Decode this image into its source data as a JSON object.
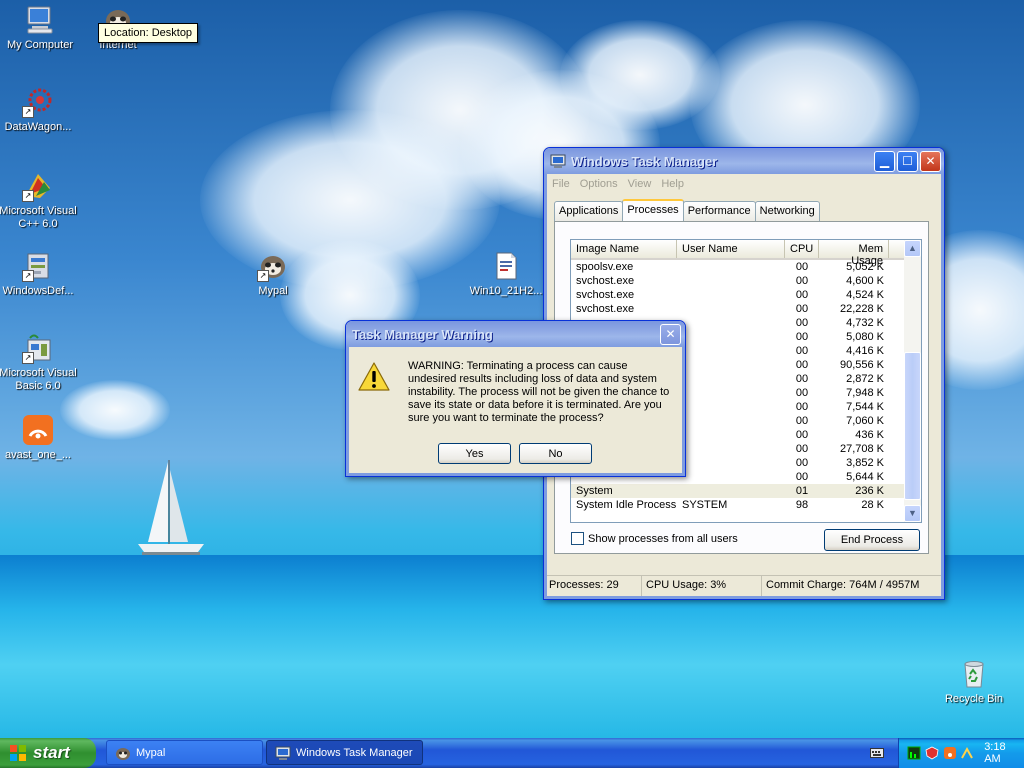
{
  "desktop": {
    "icons": [
      {
        "label": "My Computer"
      },
      {
        "label": "Internet"
      },
      {
        "label": "DataWagon..."
      },
      {
        "label": "Microsoft Visual C++ 6.0"
      },
      {
        "label": "WindowsDef..."
      },
      {
        "label": "Mypal"
      },
      {
        "label": "Win10_21H2..."
      },
      {
        "label": "Microsoft Visual Basic 6.0"
      },
      {
        "label": "avast_one_..."
      },
      {
        "label": "Recycle Bin"
      }
    ],
    "tooltip": "Location: Desktop"
  },
  "taskmgr": {
    "title": "Windows Task Manager",
    "menu": [
      "File",
      "Options",
      "View",
      "Help"
    ],
    "tabs": [
      "Applications",
      "Processes",
      "Performance",
      "Networking"
    ],
    "selected_tab": "Processes",
    "columns": [
      "Image Name",
      "User Name",
      "CPU",
      "Mem Usage"
    ],
    "rows": [
      {
        "name": "spoolsv.exe",
        "user": "",
        "cpu": "00",
        "mem": "5,052 K"
      },
      {
        "name": "svchost.exe",
        "user": "",
        "cpu": "00",
        "mem": "4,600 K"
      },
      {
        "name": "svchost.exe",
        "user": "",
        "cpu": "00",
        "mem": "4,524 K"
      },
      {
        "name": "svchost.exe",
        "user": "",
        "cpu": "00",
        "mem": "22,228 K"
      },
      {
        "name": "",
        "user": "",
        "cpu": "00",
        "mem": "4,732 K"
      },
      {
        "name": "",
        "user": "",
        "cpu": "00",
        "mem": "5,080 K"
      },
      {
        "name": "",
        "user": "",
        "cpu": "00",
        "mem": "4,416 K"
      },
      {
        "name": "",
        "user": "",
        "cpu": "00",
        "mem": "90,556 K"
      },
      {
        "name": "",
        "user": "",
        "cpu": "00",
        "mem": "2,872 K"
      },
      {
        "name": "",
        "user": "",
        "cpu": "00",
        "mem": "7,948 K"
      },
      {
        "name": "",
        "user": "",
        "cpu": "00",
        "mem": "7,544 K"
      },
      {
        "name": "",
        "user": "",
        "cpu": "00",
        "mem": "7,060 K"
      },
      {
        "name": "",
        "user": "",
        "cpu": "00",
        "mem": "436 K"
      },
      {
        "name": "",
        "user": "",
        "cpu": "00",
        "mem": "27,708 K"
      },
      {
        "name": "",
        "user": "",
        "cpu": "00",
        "mem": "3,852 K"
      },
      {
        "name": "",
        "user": "",
        "cpu": "00",
        "mem": "5,644 K"
      },
      {
        "name": "System",
        "user": "",
        "cpu": "01",
        "mem": "236 K"
      },
      {
        "name": "System Idle Process",
        "user": "SYSTEM",
        "cpu": "98",
        "mem": "28 K"
      }
    ],
    "show_all_label": "Show processes from all users",
    "end_process_label": "End Process",
    "status": {
      "processes": "Processes: 29",
      "cpu": "CPU Usage: 3%",
      "commit": "Commit Charge: 764M / 4957M"
    }
  },
  "warning": {
    "title": "Task Manager Warning",
    "message": "WARNING: Terminating a process can cause undesired results including loss of data and system instability. The process will not be given the chance to save its state or data before it is terminated.  Are you sure you want to terminate the process?",
    "yes_label": "Yes",
    "no_label": "No"
  },
  "taskbar": {
    "start_label": "start",
    "items": [
      {
        "label": "Mypal"
      },
      {
        "label": "Windows Task Manager"
      }
    ],
    "clock": "3:18 AM"
  },
  "colors": {
    "title_active": "#0050ee",
    "title_inactive": "#8ba5e3",
    "start_green": "#3c9a3c",
    "taskbar_blue": "#2157d7"
  }
}
